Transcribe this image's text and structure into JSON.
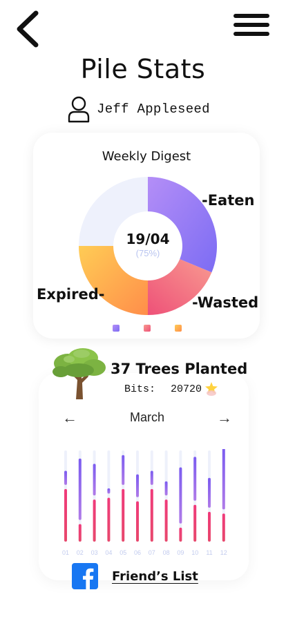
{
  "header": {
    "title": "Pile Stats",
    "back_icon": "chevron-left-icon",
    "menu_icon": "hamburger-menu-icon"
  },
  "user": {
    "name": "Jeff Appleseed",
    "icon": "user-icon"
  },
  "digest": {
    "title": "Weekly Digest",
    "center_value": "19/04",
    "center_percent": "(75%)",
    "labels": {
      "eaten": "-Eaten",
      "wasted": "-Wasted",
      "expired": "Expired-"
    },
    "colors": {
      "eaten": [
        "#b48ef7",
        "#7c6cf3"
      ],
      "wasted": [
        "#f89a90",
        "#ee5178"
      ],
      "expired": [
        "#ffcc55",
        "#ff8e4a"
      ],
      "track": "#eef1fc"
    }
  },
  "trees": {
    "text": "37 Trees Planted",
    "bits_label": "Bits:",
    "bits_value": "20720"
  },
  "monthly": {
    "month": "March",
    "prev_arrow": "←",
    "next_arrow": "→",
    "colors": {
      "top": [
        "#7b5cf0",
        "#b07be8"
      ],
      "bottom": [
        "#f03a7a",
        "#e8486c"
      ],
      "track": "#eef1fb",
      "tick": "#c2cbee"
    }
  },
  "chart_data": {
    "type": "bar",
    "categories": [
      "01",
      "02",
      "03",
      "04",
      "05",
      "06",
      "07",
      "08",
      "09",
      "10",
      "11",
      "12"
    ],
    "series": [
      {
        "values": [
          30,
          10,
          24,
          25,
          30,
          23,
          30,
          24,
          8,
          21,
          17,
          16
        ]
      },
      {
        "values": [
          8,
          35,
          18,
          3,
          17,
          13,
          8,
          8,
          32,
          25,
          17,
          35
        ]
      }
    ],
    "ylim": [
      0,
      52
    ]
  },
  "social": {
    "friends_label": "Friend’s List",
    "facebook_icon": "facebook-icon"
  }
}
